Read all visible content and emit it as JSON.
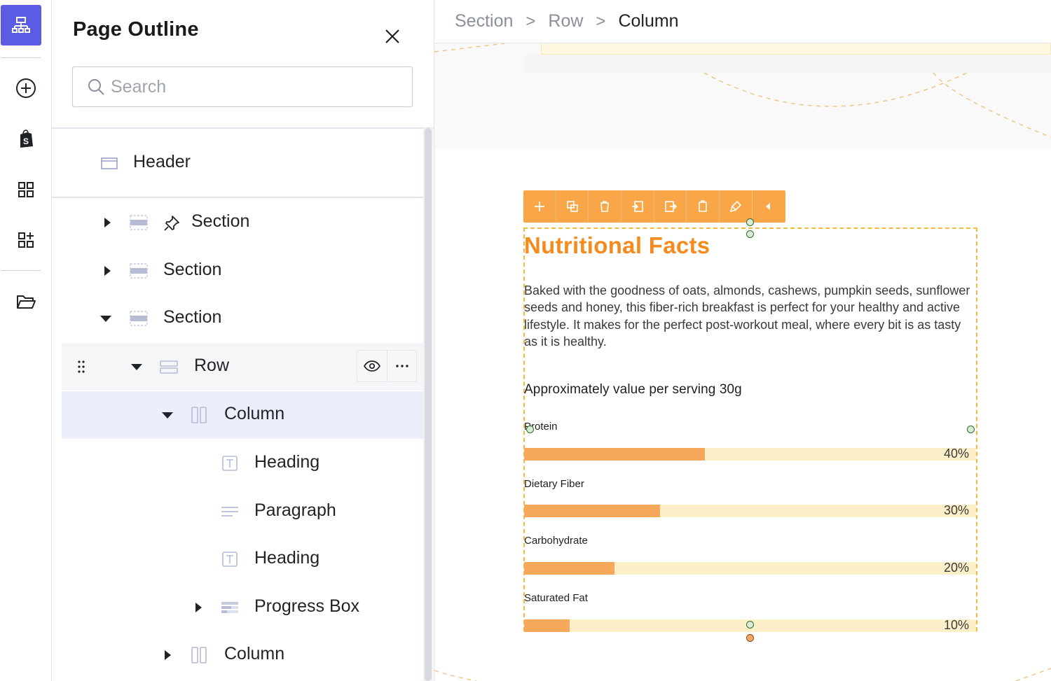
{
  "rail": {
    "items": [
      {
        "icon": "outline-tree-icon",
        "active": true
      },
      {
        "icon": "add-circle-icon"
      },
      {
        "icon": "shopify-bag-icon"
      },
      {
        "icon": "grid-icon"
      },
      {
        "icon": "grid-add-icon"
      },
      {
        "icon": "folder-open-icon"
      }
    ],
    "accent": "#5b5ce6"
  },
  "panel": {
    "title": "Page Outline",
    "search": {
      "placeholder": "Search",
      "value": ""
    },
    "tree": [
      {
        "label": "Header",
        "icon": "header-block-icon"
      },
      {
        "label": "Section",
        "icon": "section-icon",
        "pinned": true,
        "expanded": false
      },
      {
        "label": "Section",
        "icon": "section-icon",
        "expanded": false
      },
      {
        "label": "Section",
        "icon": "section-icon",
        "expanded": true
      },
      {
        "label": "Row",
        "icon": "row-icon",
        "expanded": true,
        "hovered": true
      },
      {
        "label": "Column",
        "icon": "column-icon",
        "expanded": true,
        "selected": true
      },
      {
        "label": "Heading",
        "icon": "heading-icon"
      },
      {
        "label": "Paragraph",
        "icon": "paragraph-icon"
      },
      {
        "label": "Heading",
        "icon": "heading-icon"
      },
      {
        "label": "Progress Box",
        "icon": "progress-box-icon",
        "expanded": false
      },
      {
        "label": "Column",
        "icon": "column-icon",
        "expanded": false
      }
    ]
  },
  "breadcrumb": {
    "items": [
      "Section",
      "Row",
      "Column"
    ],
    "separator": ">"
  },
  "element_toolbar": {
    "buttons": [
      "add-icon",
      "duplicate-icon",
      "delete-icon",
      "import-icon",
      "export-icon",
      "copy-icon",
      "style-brush-icon",
      "collapse-arrow-icon"
    ],
    "color": "#f8a647"
  },
  "content": {
    "heading": "Nutritional Facts",
    "paragraph": "Baked with the goodness of oats, almonds, cashews, pumpkin seeds, sunflower seeds and honey, this fiber-rich breakfast is perfect for your healthy and active lifestyle. It makes for the perfect post-workout meal, where every bit is as tasty as it is healthy.",
    "subheading": "Approximately value per serving 30g",
    "progress": [
      {
        "label": "Protein",
        "value": 40,
        "display": "40%"
      },
      {
        "label": "Dietary Fiber",
        "value": 30,
        "display": "30%"
      },
      {
        "label": "Carbohydrate",
        "value": 20,
        "display": "20%"
      },
      {
        "label": "Saturated Fat",
        "value": 10,
        "display": "10%"
      }
    ],
    "colors": {
      "heading": "#f58b1f",
      "bar_fill": "#f8a85a",
      "bar_track": "#fdf0c9"
    }
  }
}
